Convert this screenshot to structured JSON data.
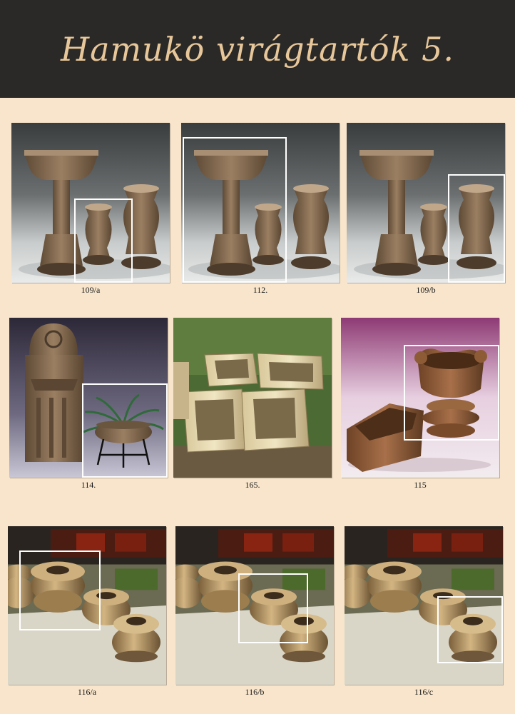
{
  "page": {
    "title": "Hamukö virágtartók 5."
  },
  "items": [
    {
      "caption": "109/a",
      "image": "pedestal-planter-and-two-urns"
    },
    {
      "caption": "112.",
      "image": "pedestal-planter-and-two-urns"
    },
    {
      "caption": "109/b",
      "image": "pedestal-planter-and-two-urns"
    },
    {
      "caption": "114.",
      "image": "wall-fountain-and-hanging-fern-bowl"
    },
    {
      "caption": "165.",
      "image": "four-square-troughs-on-grass"
    },
    {
      "caption": "115",
      "image": "carved-bowl-and-rectangular-trough"
    },
    {
      "caption": "116/a",
      "image": "three-round-pots-outdoors"
    },
    {
      "caption": "116/b",
      "image": "three-round-pots-outdoors"
    },
    {
      "caption": "116/c",
      "image": "three-round-pots-outdoors"
    }
  ],
  "colors": {
    "background": "#f8e5cb",
    "header": "#2b2927",
    "title": "#e7c79a",
    "stone": "#8a6e52"
  }
}
